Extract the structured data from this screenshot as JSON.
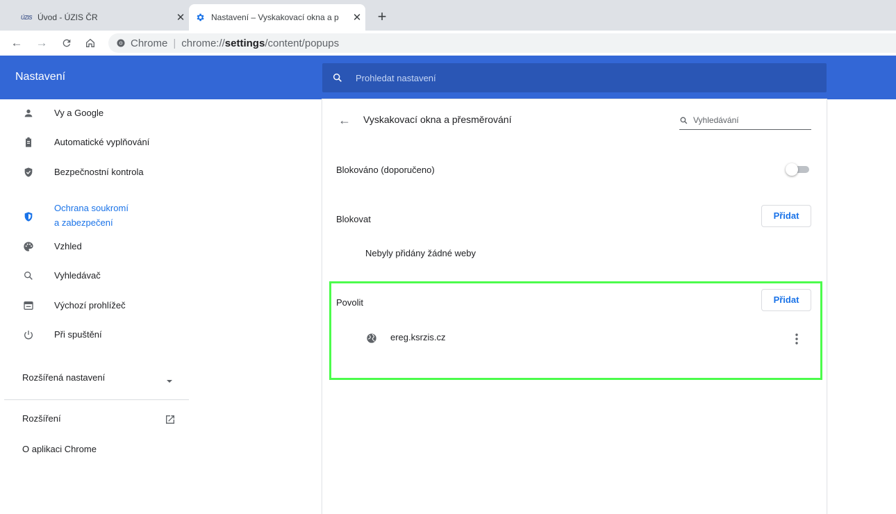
{
  "tabs": [
    {
      "title": "Úvod - ÚZIS ČR",
      "logo_text": "ÚZIS",
      "active": false
    },
    {
      "title": "Nastavení – Vyskakovací okna a p",
      "active": true
    }
  ],
  "new_tab_label": "+",
  "close_glyph": "✕",
  "toolbar": {
    "back_glyph": "←",
    "forward_glyph": "→",
    "reload_glyph": "C",
    "home_glyph": "⌂",
    "chip_label": "Chrome",
    "separator": "|",
    "url_prefix": "chrome://",
    "url_host": "settings",
    "url_path": "/content/popups"
  },
  "header": {
    "title": "Nastavení",
    "search_placeholder": "Prohledat nastavení"
  },
  "sidebar": {
    "items": [
      {
        "label": "Vy a Google",
        "icon": "person-icon"
      },
      {
        "label": "Automatické vyplňování",
        "icon": "clipboard-icon"
      },
      {
        "label": "Bezpečnostní kontrola",
        "icon": "shield-check-icon"
      },
      {
        "label_line1": "Ochrana soukromí",
        "label_line2": "a zabezpečení",
        "icon": "shield-privacy-icon",
        "selected": true
      },
      {
        "label": "Vzhled",
        "icon": "palette-icon"
      },
      {
        "label": "Vyhledávač",
        "icon": "search-icon"
      },
      {
        "label": "Výchozí prohlížeč",
        "icon": "browser-window-icon"
      },
      {
        "label": "Při spuštění",
        "icon": "power-icon"
      }
    ],
    "advanced": "Rozšířená nastavení",
    "extensions": "Rozšíření",
    "about": "O aplikaci Chrome"
  },
  "main": {
    "back_glyph": "←",
    "page_title": "Vyskakovací okna a přesměrování",
    "search_placeholder": "Vyhledávání",
    "toggle_label": "Blokováno (doporučeno)",
    "toggle_on": false,
    "block_section": {
      "label": "Blokovat",
      "add_button": "Přidat",
      "empty_message": "Nebyly přidány žádné weby"
    },
    "allow_section": {
      "label": "Povolit",
      "add_button": "Přidat",
      "sites": [
        "ereg.ksrzis.cz"
      ]
    }
  },
  "colors": {
    "header_blue": "#3367d6",
    "accent": "#1a73e8",
    "highlight_green": "#4cfc4c"
  }
}
